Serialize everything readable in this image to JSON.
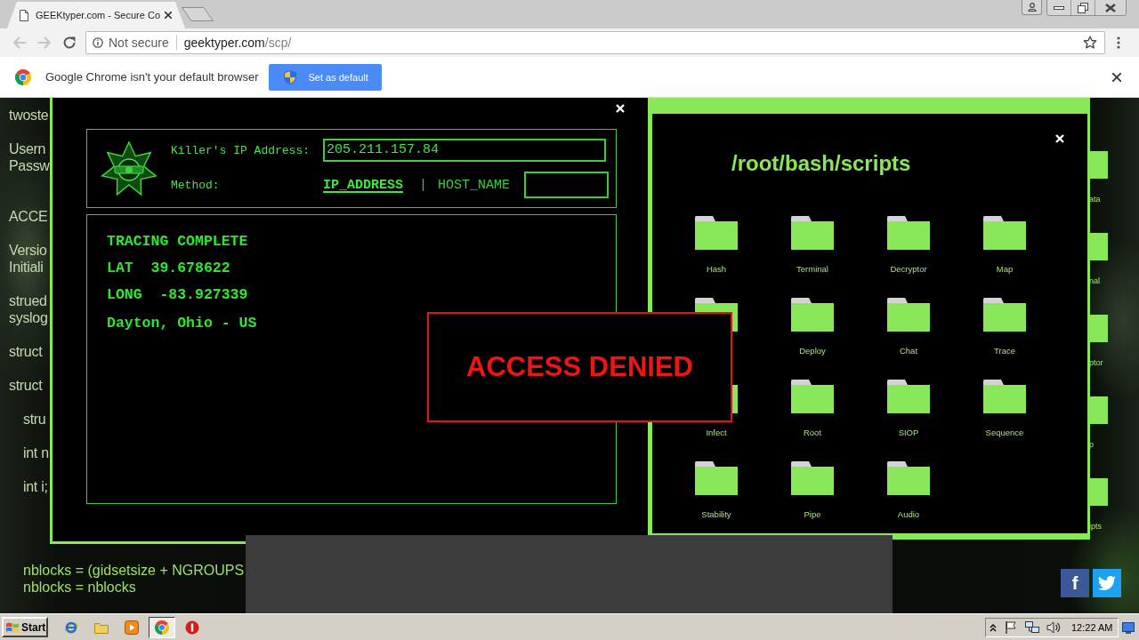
{
  "browser": {
    "tab": {
      "title": "GEEKtyper.com - Secure Co"
    },
    "toolbar": {
      "back": {
        "disabled": true
      },
      "forward": {
        "disabled": true
      }
    },
    "address": {
      "security": "Not secure",
      "host": "geektyper.com",
      "path": "/scp/"
    },
    "infobar": {
      "message": "Google Chrome isn't your default browser",
      "button": "Set as default"
    }
  },
  "background": {
    "code_blocks": [
      {
        "lines": [
          "twoste"
        ]
      },
      {
        "lines": [
          "Usern",
          "Passw"
        ]
      },
      {
        "lines": [
          "ACCE"
        ]
      },
      {
        "lines": [
          "Versio",
          "Initiali"
        ]
      },
      {
        "lines": [
          "strued",
          "syslog"
        ]
      },
      {
        "lines": [
          "struct"
        ]
      },
      {
        "lines": [
          "struct"
        ],
        "children": [
          {
            "lines": [
              "stru"
            ]
          },
          {
            "lines": [
              "int n"
            ]
          },
          {
            "lines": [
              "int i;"
            ]
          }
        ]
      }
    ],
    "code_tail": [
      "nblocks = (gidsetsize + NGROUPS",
      "nblocks = nblocks"
    ],
    "side_folders": [
      {
        "label": "ata"
      },
      {
        "label": "nal"
      },
      {
        "label": "ptor"
      },
      {
        "label": "p"
      },
      {
        "label": "ipts"
      }
    ]
  },
  "trace_window": {
    "ip_label": "Killer's IP Address:",
    "ip_value": "205.211.157.84",
    "method_label": "Method:",
    "methods": [
      {
        "label": "IP_ADDRESS",
        "selected": true
      },
      {
        "label": "HOST_NAME",
        "selected": false
      }
    ],
    "separator": "|",
    "results": [
      "TRACING COMPLETE",
      "LAT  39.678622",
      "LONG  -83.927339",
      "Dayton, Ohio - US"
    ]
  },
  "scripts_window": {
    "title": "/root/bash/scripts",
    "folders": [
      {
        "kind": "folder",
        "label": "Hash"
      },
      {
        "kind": "folder",
        "label": "Terminal"
      },
      {
        "kind": "folder",
        "label": "Decryptor"
      },
      {
        "kind": "folder",
        "label": "Map"
      },
      {
        "kind": "folder"
      },
      {
        "kind": "folder",
        "label": "Deploy"
      },
      {
        "kind": "folder",
        "label": "Chat"
      },
      {
        "kind": "folder",
        "label": "Trace"
      },
      {
        "kind": "folder",
        "label": "Infect"
      },
      {
        "kind": "folder",
        "label": "Root"
      },
      {
        "kind": "folder",
        "label": "SIOP"
      },
      {
        "kind": "folder",
        "label": "Sequence"
      },
      {
        "kind": "folder",
        "label": "Stability"
      },
      {
        "kind": "folder",
        "label": "Pipe"
      },
      {
        "kind": "folder",
        "label": "Audio"
      }
    ]
  },
  "alert": {
    "text": "ACCESS DENIED"
  },
  "social": [
    {
      "kind": "facebook",
      "label": "f"
    },
    {
      "kind": "twitter"
    }
  ],
  "taskbar": {
    "start": "Start",
    "apps": [
      {
        "kind": "ie",
        "selected": false
      },
      {
        "kind": "folder",
        "selected": false
      },
      {
        "kind": "media",
        "selected": false
      },
      {
        "kind": "chrome",
        "selected": true
      },
      {
        "kind": "stop",
        "selected": false
      }
    ],
    "clock": "12:22 AM"
  }
}
